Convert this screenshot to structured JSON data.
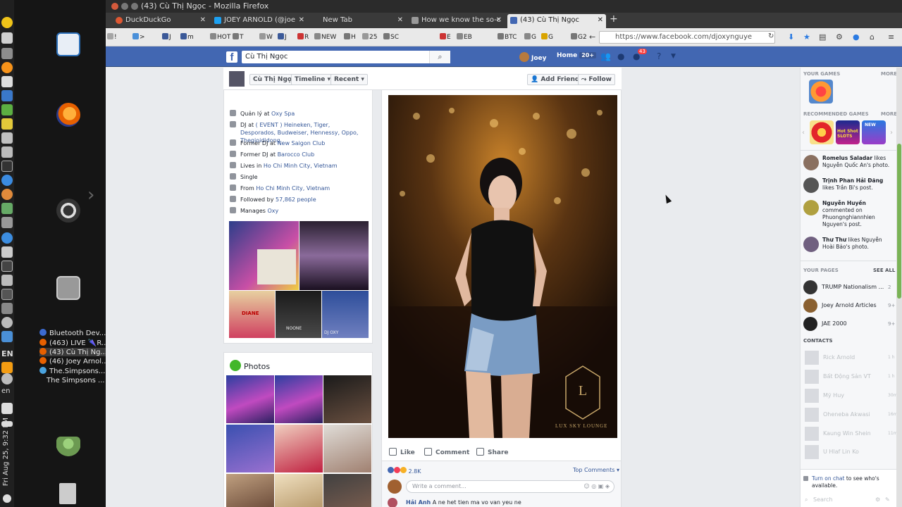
{
  "window": {
    "title": "(43) Cù Thị Ngọc - Mozilla Firefox"
  },
  "panel": {
    "clock": "Fri Aug 25, 9:32 PM",
    "lang_en": "EN",
    "lang_en2": "en"
  },
  "dock": {
    "windows": [
      {
        "label": "Bluetooth Dev..."
      },
      {
        "label": "(463) LIVE 🌂R..."
      },
      {
        "label": "(43) Cù Thị Ng..."
      },
      {
        "label": "(46) Joey Arnol..."
      },
      {
        "label": "The.Simpsons...."
      },
      {
        "label": "The Simpsons ..."
      }
    ]
  },
  "tabs": [
    {
      "label": "DuckDuckGo",
      "color": "#de5833"
    },
    {
      "label": "JOEY ARNOLD (@joe",
      "color": "#1da1f2"
    },
    {
      "label": "New Tab",
      "color": "#3a3a3a"
    },
    {
      "label": "How we know the so-c",
      "color": "#888888"
    },
    {
      "label": "(43) Cù Thị Ngọc",
      "color": "#4267b2"
    }
  ],
  "bookmarks": [
    {
      "label": "!",
      "color": "#a5a5a5"
    },
    {
      "label": ">",
      "color": "#4a90d9"
    },
    {
      "label": "J",
      "color": "#3b5998"
    },
    {
      "label": "m",
      "color": "#3b5998"
    },
    {
      "label": "HOT",
      "color": "#888888"
    },
    {
      "label": "T",
      "color": "#777777"
    },
    {
      "label": "W",
      "color": "#999999"
    },
    {
      "label": "J",
      "color": "#3b5998"
    },
    {
      "label": "R",
      "color": "#cc3333"
    },
    {
      "label": "NEW",
      "color": "#888888"
    },
    {
      "label": "H",
      "color": "#777777"
    },
    {
      "label": "25",
      "color": "#999999"
    },
    {
      "label": "SC",
      "color": "#777777"
    },
    {
      "label": "E",
      "color": "#cc3333"
    },
    {
      "label": "EB",
      "color": "#888888"
    },
    {
      "label": "BTC",
      "color": "#777777"
    },
    {
      "label": "G",
      "color": "#888888"
    },
    {
      "label": "G",
      "color": "#d9a400"
    },
    {
      "label": "G2",
      "color": "#777777"
    }
  ],
  "urlbar": {
    "url": "https://www.facebook.com/djoxynguye"
  },
  "facebook": {
    "logo": "f",
    "search_value": "Cù Thị Ngọc",
    "search_icon": "search-icon",
    "user_name": "Joey",
    "home_label": "Home",
    "home_badge": "20+",
    "notif_badge": "43"
  },
  "profile_bar": {
    "name_btn": "Cù Thị Ngọc",
    "timeline_btn": "Timeline ▾",
    "recent_btn": "Recent ▾",
    "add_friend": "Add Friend",
    "follow": "Follow"
  },
  "intro": {
    "rows": [
      {
        "prefix": "Quản lý at ",
        "link": "Oxy Spa"
      },
      {
        "prefix": "DJ at ",
        "link": "( EVENT ) Heineken, Tiger, Desporados, Budweiser, Hennessy, Oppo, Thegioididong"
      },
      {
        "prefix": "Former DJ at ",
        "link": "New Saigon Club"
      },
      {
        "prefix": "Former DJ at ",
        "link": "Barocco Club"
      },
      {
        "prefix": "Lives in ",
        "link": "Ho Chi Minh City, Vietnam"
      },
      {
        "prefix": "Single",
        "link": ""
      },
      {
        "prefix": "From ",
        "link": "Ho Chi Minh City, Vietnam"
      },
      {
        "prefix": "Followed by ",
        "link": "57,862 people"
      },
      {
        "prefix": "Manages ",
        "link": "Oxy"
      }
    ],
    "photo_text_1": "DJ OXY",
    "photo_text_2": "DIANE",
    "photo_text_3": "NOONE",
    "photo_text_4": "DJ OXY"
  },
  "photos_section": {
    "title": "Photos"
  },
  "post": {
    "watermark": "LUX SKY LOUNGE",
    "like": "Like",
    "comment": "Comment",
    "share": "Share",
    "reactions_count": "2.8K",
    "top_comments": "Top Comments ▾",
    "comment_placeholder": "Write a comment...",
    "comment_author": "Hải Anh",
    "comment_text": "A ne het tien ma vo van yeu ne"
  },
  "right": {
    "your_games": "YOUR GAMES",
    "more": "MORE",
    "recommended_games": "RECOMMENDED GAMES",
    "game_label_1": "Hot Shot SLOTS",
    "game_label_2": "NEW",
    "ticker": [
      {
        "name": "Romelus Saladar",
        "text": " likes Nguyễn Quốc An's photo."
      },
      {
        "name": "Trịnh Phan Hải Đăng",
        "text": " likes Trần Bi's post."
      },
      {
        "name": "Nguyễn Huyền",
        "text": " commented on Phuongnghiannhien Nguyen's post."
      },
      {
        "name": "Thư Thư",
        "text": " likes Nguyễn Hoài Bảo's photo."
      }
    ],
    "your_pages": "YOUR PAGES",
    "see_all": "SEE ALL",
    "pages": [
      {
        "name": "TRUMP Nationalism ...",
        "count": "2"
      },
      {
        "name": "Joey Arnold Articles",
        "count": "9+"
      },
      {
        "name": "JAE 2000",
        "count": "9+"
      }
    ],
    "contacts": "CONTACTS",
    "contact_list": [
      {
        "name": "Rick Arnold",
        "time": "1 h"
      },
      {
        "name": "Bất Động Sản VT",
        "time": "1 h"
      },
      {
        "name": "Mỹ Huy",
        "time": "30m"
      },
      {
        "name": "Oheneba Akwasi",
        "time": "16m"
      },
      {
        "name": "Kaung Win Shein",
        "time": "11m"
      },
      {
        "name": "U Hlaf Lin Ko",
        "time": ""
      }
    ],
    "chat_link": "Turn on chat",
    "chat_text": " to see who's available.",
    "search_placeholder": "Search"
  }
}
